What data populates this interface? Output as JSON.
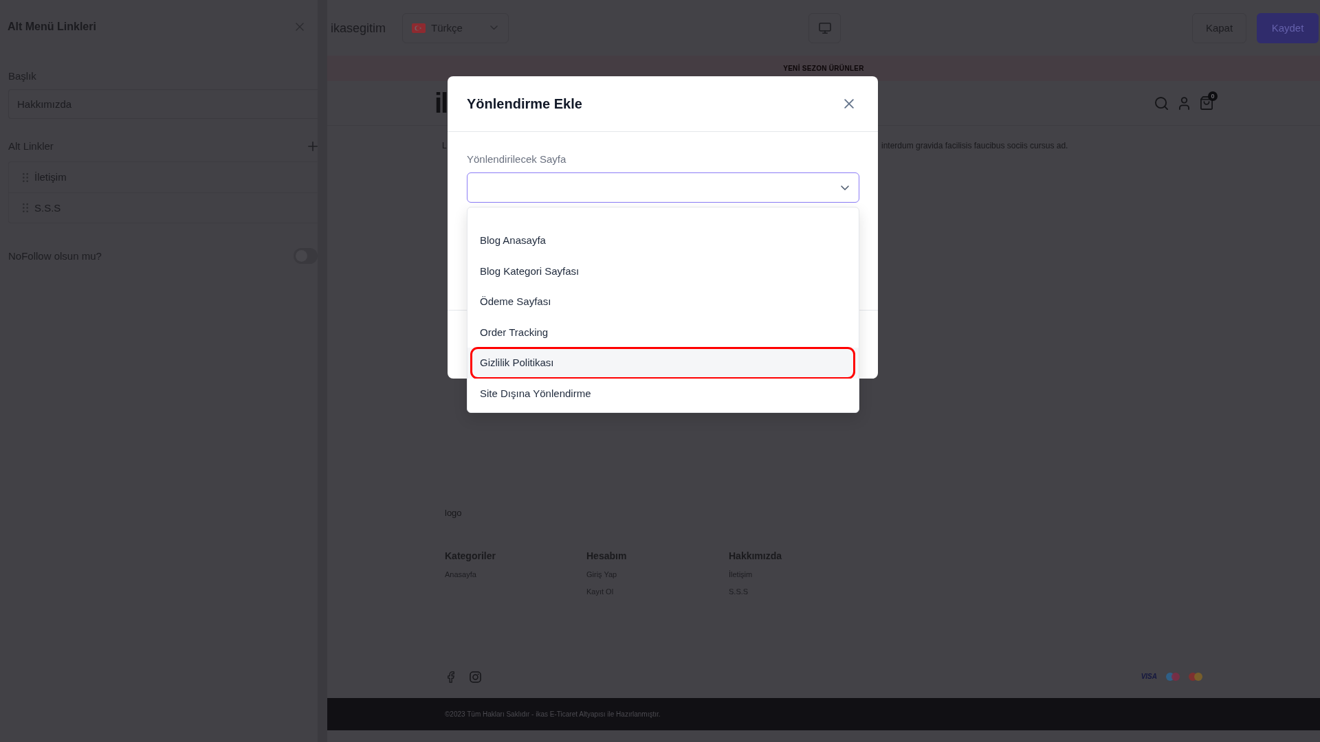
{
  "side_panel": {
    "title": "Alt Menü Linkleri",
    "title_field": {
      "label": "Başlık",
      "value": "Hakkımızda"
    },
    "sub_links": {
      "label": "Alt Linkler",
      "items": [
        "İletişim",
        "S.S.S"
      ]
    },
    "nofollow": {
      "label": "NoFollow olsun mu?",
      "on": false
    }
  },
  "top_bar": {
    "store_name": "ikasegitim",
    "language": "Türkçe",
    "buttons": [
      {
        "label": "Kapat",
        "kind": "secondary"
      },
      {
        "label": "Kaydet",
        "kind": "primary"
      }
    ]
  },
  "preview": {
    "announcement": "YENİ SEZON ÜRÜNLER",
    "logo": "il",
    "cart_count": "0",
    "body_text": [
      "L",
      "interdum gravida facilisis faucibus sociis cursus ad."
    ],
    "footer": {
      "logo": "logo",
      "columns": [
        {
          "title": "Kategoriler",
          "links": [
            "Anasayfa"
          ]
        },
        {
          "title": "Hesabım",
          "links": [
            "Giriş Yap",
            "Kayıt Ol"
          ]
        },
        {
          "title": "Hakkımızda",
          "links": [
            "İletişim",
            "S.S.S"
          ]
        }
      ],
      "payment_methods": [
        {
          "kind": "visa",
          "label": "VISA"
        },
        {
          "kind": "maestro"
        },
        {
          "kind": "mastercard"
        }
      ],
      "copyright": "©2023 Tüm Hakları Saklıdır - ikas E-Ticaret Altyapısı ile Hazırlanmıştır."
    }
  },
  "modal": {
    "title": "Yönlendirme Ekle",
    "field": {
      "label": "Yönlendirilecek Sayfa",
      "expanded": true
    },
    "options": [
      {
        "label": "Blog Anasayfa",
        "selected": false,
        "circled": false
      },
      {
        "label": "Blog Kategori Sayfası",
        "selected": false,
        "circled": false
      },
      {
        "label": "Ödeme Sayfası",
        "selected": false,
        "circled": false
      },
      {
        "label": "Order Tracking",
        "selected": false,
        "circled": false
      },
      {
        "label": "Gizlilik Politikası",
        "selected": true,
        "circled": true
      },
      {
        "label": "Site Dışına Yönlendirme",
        "selected": false,
        "circled": false
      }
    ]
  }
}
